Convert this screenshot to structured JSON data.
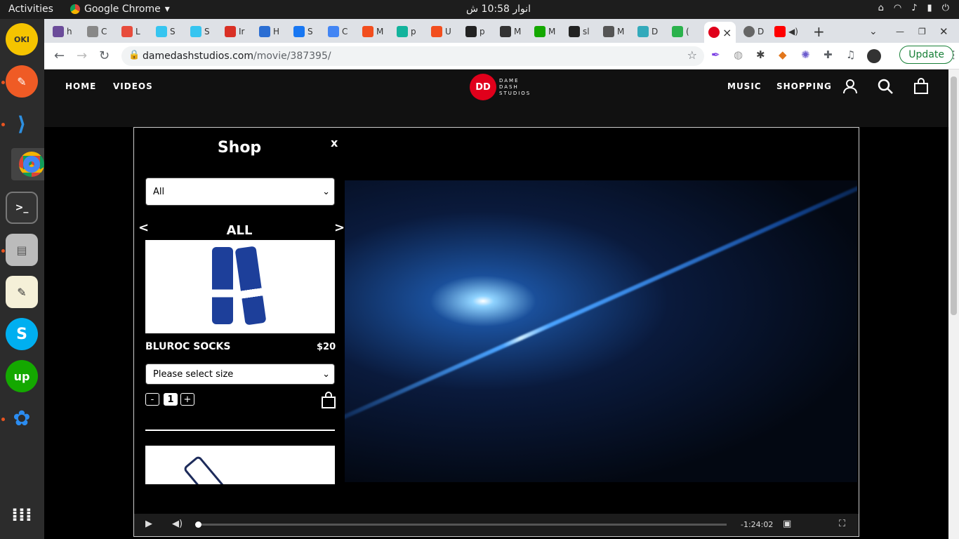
{
  "os": {
    "activities": "Activities",
    "app": "Google Chrome",
    "clock": "انوار 10:58 ش"
  },
  "browser": {
    "tabs": [
      {
        "short": "h",
        "color": "#6b4c9a"
      },
      {
        "short": "C",
        "color": "#888"
      },
      {
        "short": "L",
        "color": "#e74c3c"
      },
      {
        "short": "S",
        "color": "#36c5f0"
      },
      {
        "short": "S",
        "color": "#36c5f0"
      },
      {
        "short": "Ir",
        "color": "#d93025"
      },
      {
        "short": "H",
        "color": "#2b6ed3"
      },
      {
        "short": "S",
        "color": "#1877f2"
      },
      {
        "short": "C",
        "color": "#4285f4"
      },
      {
        "short": "M",
        "color": "#f24e1e"
      },
      {
        "short": "p",
        "color": "#13b39c"
      },
      {
        "short": "U",
        "color": "#f24e1e"
      },
      {
        "short": "p",
        "color": "#222"
      },
      {
        "short": "M",
        "color": "#333"
      },
      {
        "short": "M",
        "color": "#14a800"
      },
      {
        "short": "sl",
        "color": "#222"
      },
      {
        "short": "M",
        "color": "#555"
      },
      {
        "short": "D",
        "color": "#3ab"
      },
      {
        "short": "(",
        "color": "#2bb24c"
      }
    ],
    "active_tab_close": "×",
    "after_tabs": [
      {
        "short": "D",
        "color": "#666"
      },
      {
        "short": "",
        "color": "#f00"
      }
    ],
    "new_tab": "+",
    "url_domain": "damedashstudios.com",
    "url_path": "/movie/387395/",
    "update_label": "Update"
  },
  "site": {
    "nav_left": [
      "HOME",
      "VIDEOS"
    ],
    "nav_right": [
      "MUSIC",
      "SHOPPING"
    ],
    "logo_mark": "DD",
    "logo_lines": [
      "DAME",
      "DASH",
      "STUDIOS"
    ]
  },
  "shop": {
    "title": "Shop",
    "close": "x",
    "filter_value": "All",
    "category": "ALL",
    "prev": "<",
    "next": ">",
    "product": {
      "name": "BLUROC SOCKS",
      "price": "$20",
      "size_placeholder": "Please select size",
      "qty": "1",
      "minus": "-",
      "plus": "+"
    }
  },
  "player": {
    "time": "-1:24:02",
    "progress": 0.0
  }
}
